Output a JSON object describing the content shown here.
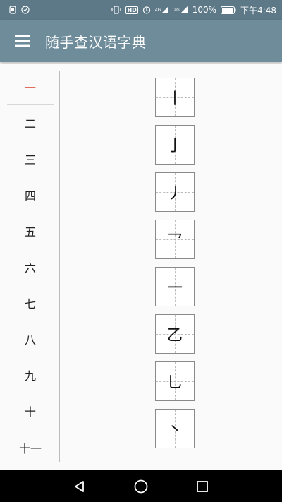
{
  "status_bar": {
    "time": "下午4:48",
    "battery": "100%",
    "network_1": "4G",
    "network_2": "2G",
    "hd": "HD"
  },
  "app_bar": {
    "title": "随手查汉语字典",
    "menu_icon": "hamburger-menu-icon"
  },
  "stroke_counts": [
    {
      "label": "一",
      "selected": true
    },
    {
      "label": "二"
    },
    {
      "label": "三"
    },
    {
      "label": "四"
    },
    {
      "label": "五"
    },
    {
      "label": "六"
    },
    {
      "label": "七"
    },
    {
      "label": "八"
    },
    {
      "label": "九"
    },
    {
      "label": "十"
    },
    {
      "label": "十一"
    }
  ],
  "characters": [
    "丨",
    "亅",
    "丿",
    "乛",
    "一",
    "乙",
    "乚",
    "丶"
  ],
  "colors": {
    "status_bar": "#5d7988",
    "app_bar": "#6e8c9a",
    "selected": "#e04b3c"
  },
  "nav": {
    "back_icon": "back-triangle-icon",
    "home_icon": "home-circle-icon",
    "recents_icon": "recents-square-icon"
  }
}
